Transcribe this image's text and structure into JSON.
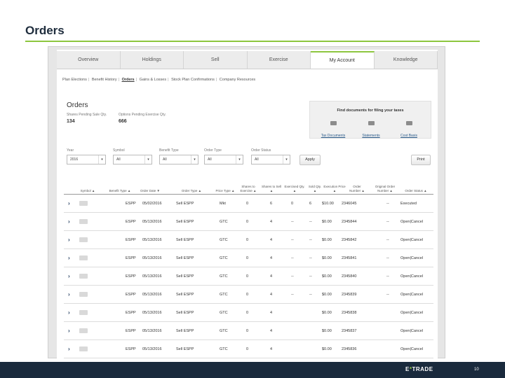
{
  "slide": {
    "title": "Orders",
    "page_number": "10",
    "logo": {
      "prefix": "E",
      "star": "*",
      "suffix": "TRADE"
    }
  },
  "tabs": [
    "Overview",
    "Holdings",
    "Sell",
    "Exercise",
    "My Account",
    "Knowledge"
  ],
  "active_tab": "My Account",
  "subnav": [
    "Plan Elections",
    "Benefit History",
    "Orders",
    "Gains & Losses",
    "Stock Plan Confirmations",
    "Company Resources"
  ],
  "current_subnav": "Orders",
  "orders": {
    "heading": "Orders",
    "pending_sale_label": "Shares Pending Sale Qty.",
    "pending_sale_value": "134",
    "pending_exercise_label": "Options Pending Exercise Qty.",
    "pending_exercise_value": "666"
  },
  "docs_box": {
    "title": "Find documents for filing your taxes",
    "links": [
      {
        "label": "Tax Documents",
        "icon": "folder-icon"
      },
      {
        "label": "Statements",
        "icon": "folder-icon"
      },
      {
        "label": "Cost Basis",
        "icon": "folder-icon"
      }
    ]
  },
  "filters": [
    {
      "label": "Year",
      "value": "2016"
    },
    {
      "label": "Symbol",
      "value": "All"
    },
    {
      "label": "Benefit Type",
      "value": "All"
    },
    {
      "label": "Order Type",
      "value": "All"
    },
    {
      "label": "Order Status",
      "value": "All"
    }
  ],
  "buttons": {
    "apply": "Apply",
    "print": "Print"
  },
  "table": {
    "columns": [
      "Symbol ▲",
      "Benefit Type ▲",
      "Order Date ▼",
      "Order Type ▲",
      "Price Type ▲",
      "Shares to Exercise ▲",
      "Shares to Sell ▲",
      "Exercised Qty. ▲",
      "Sold Qty. ▲",
      "Execution Price ▲",
      "Order Number ▲",
      "Original Order Number ▲",
      "Order Status ▲"
    ],
    "rows": [
      {
        "benefit_type": "ESPP",
        "order_date": "05/02/2016",
        "order_type": "Sell ESPP",
        "price_type": "Mkt",
        "shares_to_exercise": "0",
        "shares_to_sell": "6",
        "exercised_qty": "0",
        "sold_qty": "6",
        "execution_price": "$10.00",
        "order_number": "2346045",
        "original_order_number": "--",
        "status": "Executed"
      },
      {
        "benefit_type": "ESPP",
        "order_date": "05/13/2016",
        "order_type": "Sell ESPP",
        "price_type": "GTC",
        "shares_to_exercise": "0",
        "shares_to_sell": "4",
        "exercised_qty": "--",
        "sold_qty": "--",
        "execution_price": "$0.00",
        "order_number": "2345844",
        "original_order_number": "--",
        "status": "Open|Cancel"
      },
      {
        "benefit_type": "ESPP",
        "order_date": "05/13/2016",
        "order_type": "Sell ESPP",
        "price_type": "GTC",
        "shares_to_exercise": "0",
        "shares_to_sell": "4",
        "exercised_qty": "--",
        "sold_qty": "--",
        "execution_price": "$0.00",
        "order_number": "2345842",
        "original_order_number": "--",
        "status": "Open|Cancel"
      },
      {
        "benefit_type": "ESPP",
        "order_date": "05/13/2016",
        "order_type": "Sell ESPP",
        "price_type": "GTC",
        "shares_to_exercise": "0",
        "shares_to_sell": "4",
        "exercised_qty": "--",
        "sold_qty": "--",
        "execution_price": "$0.00",
        "order_number": "2345841",
        "original_order_number": "--",
        "status": "Open|Cancel"
      },
      {
        "benefit_type": "ESPP",
        "order_date": "05/13/2016",
        "order_type": "Sell ESPP",
        "price_type": "GTC",
        "shares_to_exercise": "0",
        "shares_to_sell": "4",
        "exercised_qty": "--",
        "sold_qty": "--",
        "execution_price": "$0.00",
        "order_number": "2345840",
        "original_order_number": "--",
        "status": "Open|Cancel"
      },
      {
        "benefit_type": "ESPP",
        "order_date": "05/13/2016",
        "order_type": "Sell ESPP",
        "price_type": "GTC",
        "shares_to_exercise": "0",
        "shares_to_sell": "4",
        "exercised_qty": "--",
        "sold_qty": "--",
        "execution_price": "$0.00",
        "order_number": "2345839",
        "original_order_number": "--",
        "status": "Open|Cancel"
      },
      {
        "benefit_type": "ESPP",
        "order_date": "05/13/2016",
        "order_type": "Sell ESPP",
        "price_type": "GTC",
        "shares_to_exercise": "0",
        "shares_to_sell": "4",
        "exercised_qty": "",
        "sold_qty": "",
        "execution_price": "$0.00",
        "order_number": "2345838",
        "original_order_number": "",
        "status": "Open|Cancel"
      },
      {
        "benefit_type": "ESPP",
        "order_date": "05/13/2016",
        "order_type": "Sell ESPP",
        "price_type": "GTC",
        "shares_to_exercise": "0",
        "shares_to_sell": "4",
        "exercised_qty": "",
        "sold_qty": "",
        "execution_price": "$0.00",
        "order_number": "2345837",
        "original_order_number": "",
        "status": "Open|Cancel"
      },
      {
        "benefit_type": "ESPP",
        "order_date": "05/13/2016",
        "order_type": "Sell ESPP",
        "price_type": "GTC",
        "shares_to_exercise": "0",
        "shares_to_sell": "4",
        "exercised_qty": "",
        "sold_qty": "",
        "execution_price": "$0.00",
        "order_number": "2345836",
        "original_order_number": "",
        "status": "Open|Cancel"
      }
    ]
  },
  "icons": {
    "row_expand": "chevron-right-icon",
    "doc": "folder-icon"
  },
  "colors": {
    "accent_green": "#8dc63f",
    "footer_navy": "#1a2a3d",
    "link_blue": "#2b5b8a"
  }
}
